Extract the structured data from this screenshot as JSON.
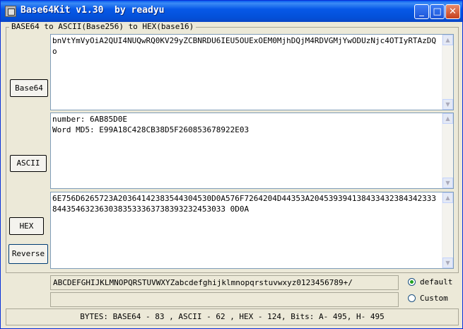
{
  "window": {
    "title": "Base64Kit v1.30  by readyu",
    "minimize_glyph": "_",
    "maximize_glyph": "□",
    "close_glyph": "✕"
  },
  "group": {
    "legend": "BASE64 to ASCII(Base256) to HEX(base16)"
  },
  "buttons": {
    "base64": "Base64",
    "ascii": "ASCII",
    "hex": "HEX",
    "reverse": "Reverse"
  },
  "textareas": {
    "base64": "bnVtYmVyOiA2QUI4NUQwRQ0KV29yZCBNRDU6IEU5OUExOEM0MjhDQjM4RDVGMjYwODUzNjc4OTIyRTAzDQo",
    "ascii": "number: 6AB85D0E\nWord MD5: E99A18C428CB38D5F260853678922E03",
    "hex": "6E756D6265723A20364142383544304530D0A576F7264204D44353A2045393941384334323843423338443546323630383533363738393232453033 0D0A"
  },
  "alphabet": {
    "value": "ABCDEFGHIJKLMNOPQRSTUVWXYZabcdefghijklmnopqrstuvwxyz0123456789+/",
    "custom_value": ""
  },
  "radios": {
    "default_label": "default",
    "custom_label": "Custom",
    "selected": "default"
  },
  "status": {
    "text": "BYTES: BASE64 - 83 , ASCII - 62 , HEX - 124, Bits: A- 495, H- 495"
  },
  "icons": {
    "scroll_up": "▲",
    "scroll_down": "▼"
  }
}
